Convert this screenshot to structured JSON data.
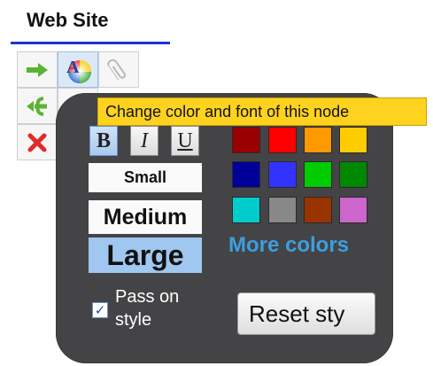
{
  "node": {
    "title": "Web Site"
  },
  "toolbar": {
    "icons": [
      "arrow-right-icon",
      "color-font-icon",
      "paperclip-icon",
      "branch-arrows-icon",
      "palette-icon",
      "delete-x-icon",
      "star-icon"
    ]
  },
  "tooltip": {
    "text": "Change color and font of this node"
  },
  "format": {
    "bold_label": "B",
    "italic_label": "I",
    "underline_label": "U",
    "bold_active": true
  },
  "sizes": {
    "small": "Small",
    "medium": "Medium",
    "large": "Large",
    "selected": "Large"
  },
  "colors": {
    "swatches": [
      "#990000",
      "#ff0000",
      "#ff9900",
      "#ffcc00",
      "#000099",
      "#3333ff",
      "#00cc00",
      "#008800",
      "#00cccc",
      "#888888",
      "#993300",
      "#cc66cc"
    ],
    "more_label": "More colors"
  },
  "pass_on_style": {
    "label_line1": "Pass on",
    "label_line2": "style",
    "checked": true
  },
  "reset": {
    "label": "Reset sty"
  },
  "theme": {
    "popup_bg": "#444446",
    "tooltip_bg": "#ffd21f",
    "accent": "#3d9ee0",
    "underline": "#1a33d6"
  }
}
